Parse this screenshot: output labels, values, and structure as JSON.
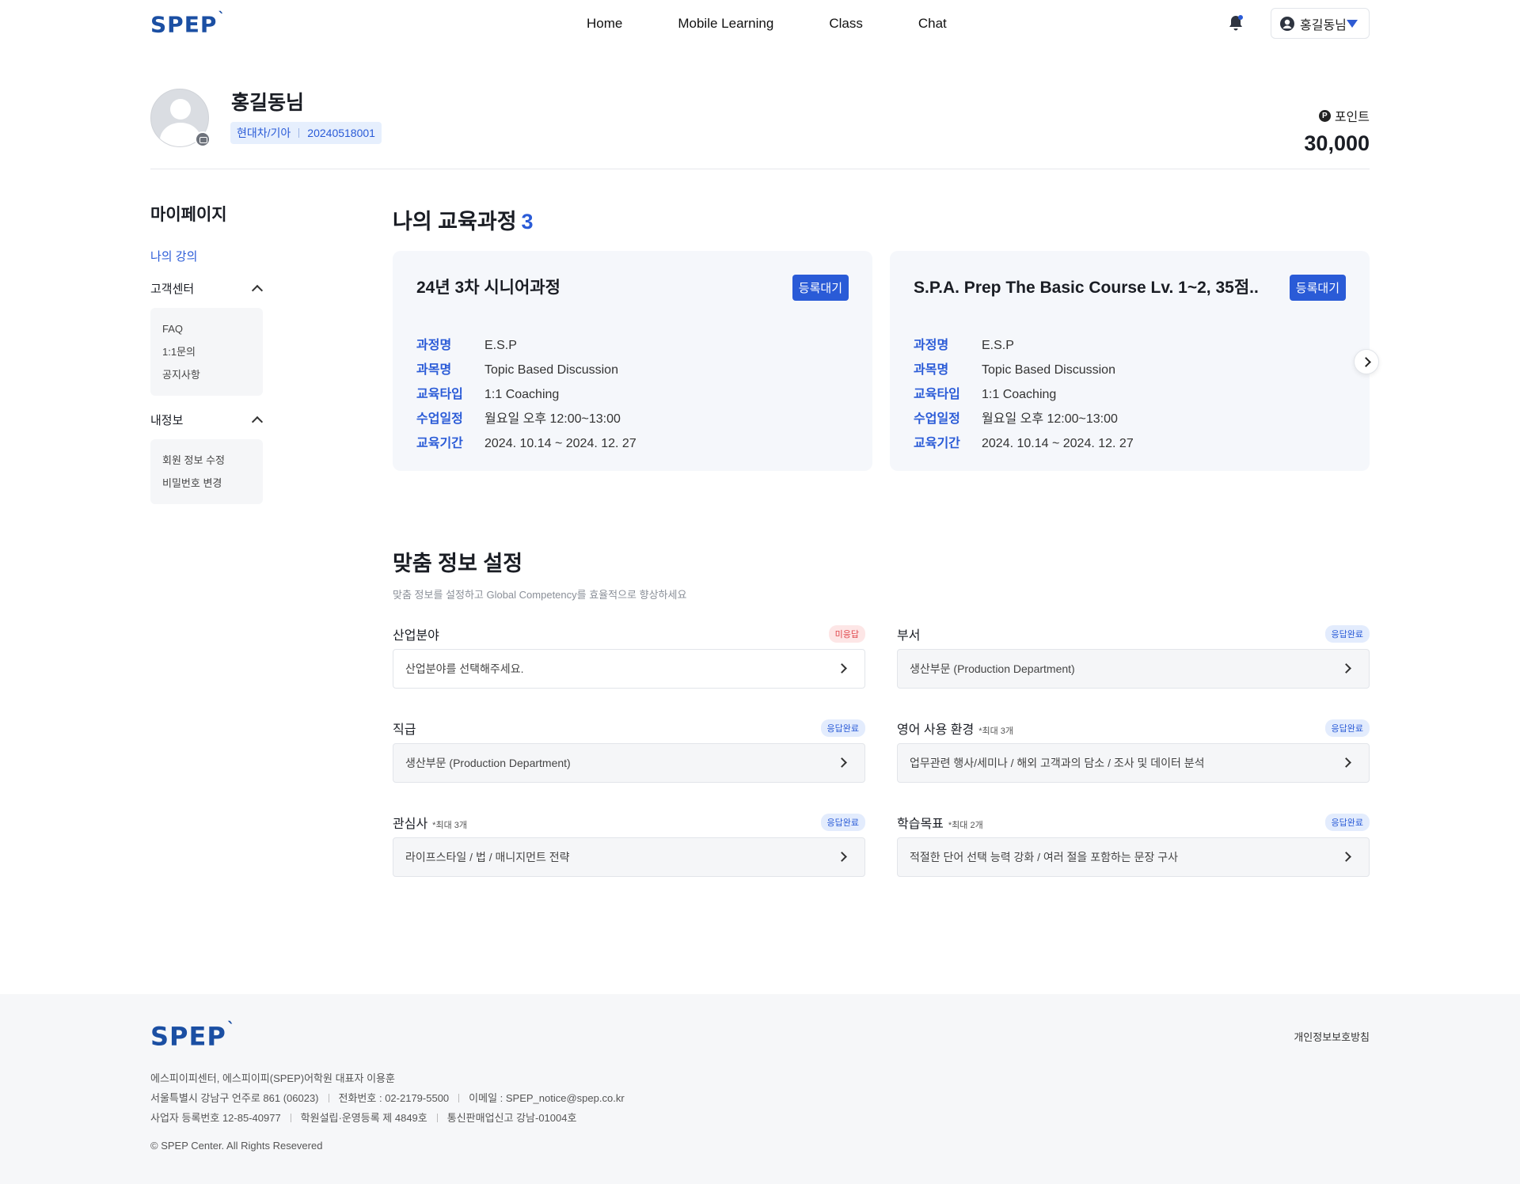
{
  "header": {
    "logo": "SPEP",
    "logo_mark": "`",
    "nav": [
      "Home",
      "Mobile Learning",
      "Class",
      "Chat"
    ],
    "user_name": "홍길동님"
  },
  "profile": {
    "name": "홍길동님",
    "company": "현대차/기아",
    "member_id": "20240518001",
    "points_icon": "P",
    "points_label": "포인트",
    "points_value": "30,000"
  },
  "sidebar": {
    "title": "마이페이지",
    "active_item": "나의 강의",
    "groups": [
      {
        "title": "고객센터",
        "items": [
          "FAQ",
          "1:1문의",
          "공지사항"
        ]
      },
      {
        "title": "내정보",
        "items": [
          "회원 정보 수정",
          "비밀번호 변경"
        ]
      }
    ]
  },
  "courses": {
    "title": "나의 교육과정",
    "count": "3",
    "labels": [
      "과정명",
      "과목명",
      "교육타입",
      "수업일정",
      "교육기간"
    ],
    "cards": [
      {
        "title": "24년 3차 시니어과정",
        "status": "등록대기",
        "values": [
          "E.S.P",
          "Topic Based Discussion",
          "1:1 Coaching",
          "월요일 오후 12:00~13:00",
          "2024. 10.14 ~ 2024. 12. 27"
        ]
      },
      {
        "title": "S.P.A. Prep The Basic Course Lv. 1~2, 35점..",
        "status": "등록대기",
        "values": [
          "E.S.P",
          "Topic Based Discussion",
          "1:1 Coaching",
          "월요일 오후 12:00~13:00",
          "2024. 10.14 ~ 2024. 12. 27"
        ]
      }
    ]
  },
  "preferences": {
    "title": "맞춤 정보 설정",
    "subtitle": "맞춤 정보를 설정하고 Global Competency를 효율적으로 향상하세요",
    "fields": [
      {
        "label": "산업분야",
        "note": "",
        "status": "미응답",
        "value": "산업분야를 선택해주세요."
      },
      {
        "label": "부서",
        "note": "",
        "status": "응답완료",
        "value": "생산부문 (Production Department)"
      },
      {
        "label": "직급",
        "note": "",
        "status": "응답완료",
        "value": "생산부문 (Production Department)"
      },
      {
        "label": "영어 사용 환경",
        "note": "*최대 3개",
        "status": "응답완료",
        "value": "업무관련 행사/세미나 / 해외 고객과의 담소 / 조사 및 데이터 분석"
      },
      {
        "label": "관심사",
        "note": "*최대 3개",
        "status": "응답완료",
        "value": "라이프스타일 / 법 / 매니지먼트 전략"
      },
      {
        "label": "학습목표",
        "note": "*최대 2개",
        "status": "응답완료",
        "value": "적절한 단어 선택 능력 강화 / 여러 절을 포함하는 문장 구사"
      }
    ]
  },
  "footer": {
    "logo": "SPEP",
    "logo_mark": "`",
    "privacy": "개인정보보호방침",
    "line1": "에스피이피센터, 에스피이피(SPEP)어학원 대표자 이용훈",
    "address": "서울특별시 강남구 언주로 861 (06023)",
    "phone": "전화번호 : 02-2179-5500",
    "email": "이메일 : SPEP_notice@spep.co.kr",
    "biz_no": "사업자 등록번호 12-85-40977",
    "academy_no": "학원설립·운영등록 제 4849호",
    "ecommerce_no": "통신판매업신고 강남-01004호",
    "copyright": "© SPEP Center. All Rights Resevered"
  },
  "colors": {
    "brand": "#1b4fa3",
    "accent": "#2a5bd7",
    "alert": "#e0474c"
  }
}
